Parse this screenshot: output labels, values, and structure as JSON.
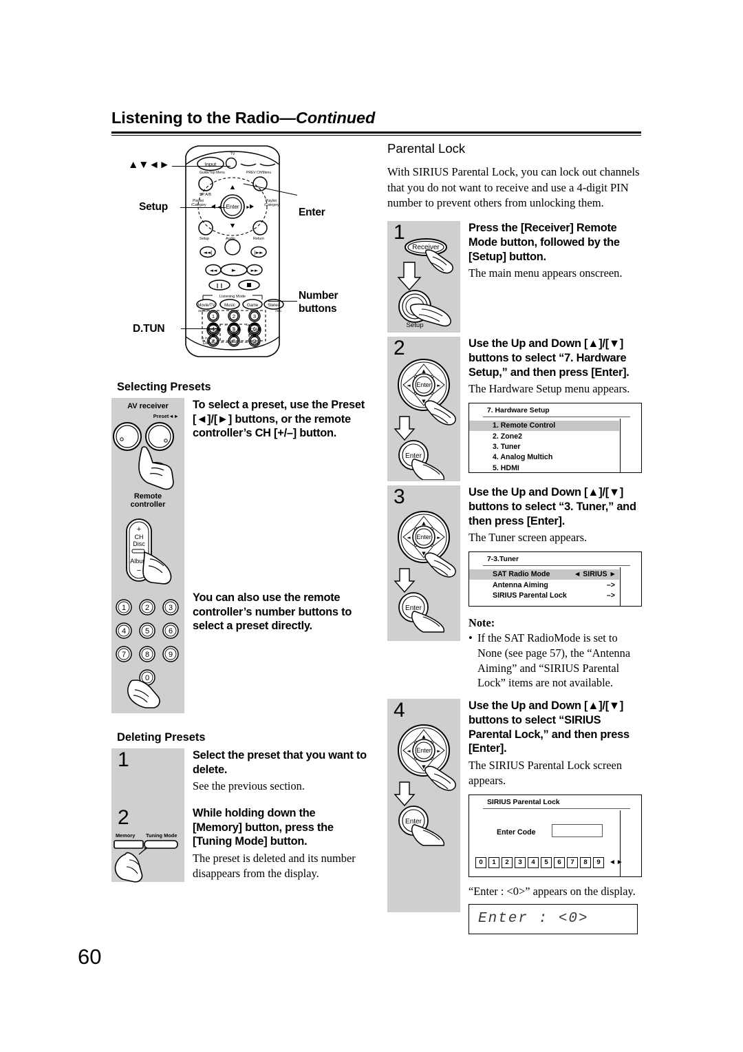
{
  "header": {
    "title_main": "Listening to the Radio",
    "title_cont": "—Continued"
  },
  "page_number": "60",
  "remote_callouts": {
    "arrows": "▲▼◄►",
    "setup": "Setup",
    "dtun": "D.TUN",
    "enter": "Enter",
    "number_buttons_l1": "Number",
    "number_buttons_l2": "buttons"
  },
  "remote_keys": {
    "tv": "TV",
    "input": "Input",
    "guide_top_menu": "Guide/Top Menu",
    "prev_ch_menu": "PREV CH/Menu",
    "sp_ab": "SP A/B",
    "playlist_category_l": "Playlist\n/Category",
    "playlist_category_r": "Playlist\n/Category",
    "enter": "Enter",
    "setup": "Setup",
    "audio": "Audio",
    "return": "Return",
    "listening_mode": "Listening Mode",
    "movie_tv": "Movie/TV",
    "music": "Music",
    "game": "Game",
    "stereo": "Stereo",
    "dtun_small": "D.TUN",
    "dimmer": "Dimmer",
    "sleep": "Sleep",
    "clr": "CLR",
    "plus10": "+10",
    "num_rows": [
      [
        "1",
        "2",
        "3"
      ],
      [
        "4",
        "5",
        "6"
      ],
      [
        "7",
        "8",
        "9"
      ]
    ],
    "zero": "0"
  },
  "left": {
    "selecting_presets_title": "Selecting Presets",
    "av_receiver_label": "AV receiver",
    "preset_label": "Preset",
    "remote_controller_l1": "Remote",
    "remote_controller_l2": "controller",
    "ch_disc_plus": "+",
    "ch_disc_ch": "CH",
    "ch_disc_disc": "Disc",
    "ch_disc_album": "Album",
    "ch_disc_minus": "−",
    "text_preset": "To select a preset, use the Preset [◄]/[►] buttons, or the remote controller’s CH [+/–] button.",
    "text_number_buttons": "You can also use the remote controller’s number buttons to select a preset directly.",
    "deleting_presets_title": "Deleting Presets",
    "steps": [
      {
        "num": "1",
        "head": "Select the preset that you want to delete.",
        "sub": "See the previous section."
      },
      {
        "num": "2",
        "head": "While holding down the [Memory] button, press the [Tuning Mode] button.",
        "sub": "The preset is deleted and its number disappears from the display.",
        "fig_label_left": "Memory",
        "fig_label_right": "Tuning Mode"
      }
    ],
    "num_pad_rows": [
      [
        "1",
        "2",
        "3"
      ],
      [
        "4",
        "5",
        "6"
      ],
      [
        "7",
        "8",
        "9"
      ]
    ],
    "num_pad_zero": "0"
  },
  "right": {
    "section_title": "Parental Lock",
    "intro": "With SIRIUS Parental Lock, you can lock out channels that you do not want to receive and use a 4-digit PIN number to prevent others from unlocking them.",
    "steps": [
      {
        "num": "1",
        "head": "Press the [Receiver] Remote Mode button, followed by the [Setup] button.",
        "sub": "The main menu appears onscreen.",
        "btn_top": "Receiver",
        "btn_bottom": "Setup"
      },
      {
        "num": "2",
        "head": "Use the Up and Down [▲]/[▼] buttons to select “7. Hardware Setup,” and then press [Enter].",
        "sub": "The Hardware Setup menu appears.",
        "btn_enter": "Enter"
      },
      {
        "num": "3",
        "head": "Use the Up and Down [▲]/[▼] buttons to select “3. Tuner,” and then press [Enter].",
        "sub": "The Tuner screen appears.",
        "btn_enter": "Enter"
      },
      {
        "num": "4",
        "head": "Use the Up and Down [▲]/[▼] buttons to select “SIRIUS Parental Lock,” and then press [Enter].",
        "sub": "The SIRIUS Parental Lock screen appears.",
        "btn_enter": "Enter"
      }
    ],
    "osd_hardware": {
      "title": "7. Hardware Setup",
      "rows": [
        {
          "label": "1. Remote Control",
          "selected": true
        },
        {
          "label": "2. Zone2",
          "selected": false
        },
        {
          "label": "3. Tuner",
          "selected": false
        },
        {
          "label": "4. Analog Multich",
          "selected": false
        },
        {
          "label": "5. HDMI",
          "selected": false
        }
      ]
    },
    "osd_tuner": {
      "title": "7-3.Tuner",
      "rows": [
        {
          "label": "SAT Radio Mode",
          "value": "◄ SIRIUS ►",
          "selected": true
        },
        {
          "label": "Antenna Aiming",
          "value": "–>",
          "selected": false
        },
        {
          "label": "SIRIUS Parental Lock",
          "value": "–>",
          "selected": false
        }
      ]
    },
    "osd_parental": {
      "title": "SIRIUS Parental Lock",
      "enter_code_label": "Enter Code",
      "code_value": "",
      "digits": [
        "0",
        "1",
        "2",
        "3",
        "4",
        "5",
        "6",
        "7",
        "8",
        "9"
      ],
      "arrows": "◄►"
    },
    "note": {
      "label": "Note:",
      "bullet": "•",
      "text": "If the SAT RadioMode is set to None (see page 57), the “Antenna Aiming” and “SIRIUS Parental Lock” items are not available."
    },
    "display_caption": "“Enter : <0>” appears on the display.",
    "display_text": "Enter  :       <0>"
  },
  "colors": {
    "figure_bg": "#cfcfcf",
    "osd_selected": "#c6c6c6",
    "ink": "#000000"
  }
}
